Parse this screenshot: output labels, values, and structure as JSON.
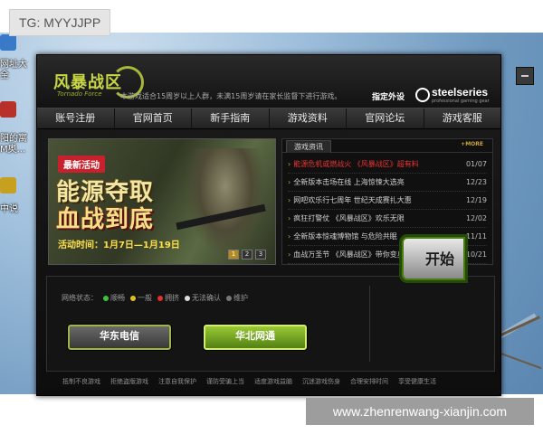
{
  "overlay": {
    "tg_label": "TG: MYYJJPP",
    "watermark": "www.zhenrenwang-xianjin.com"
  },
  "desktop": {
    "icon_texts": [
      "网址大\n全",
      "阳的寓\nM奥...",
      "中说"
    ]
  },
  "launcher": {
    "logo": {
      "title": "风暴战区",
      "subtitle": "Tornado Force"
    },
    "notice": "本游戏适合15周岁以上人群，未满15周岁请在家长监督下进行游戏。",
    "designated_peripheral": "指定外设",
    "sponsor": {
      "name": "steelseries",
      "tagline": "professional gaming gear"
    },
    "nav": [
      "账号注册",
      "官网首页",
      "新手指南",
      "游戏资料",
      "官网论坛",
      "游戏客服"
    ],
    "banner": {
      "tag": "最新活动",
      "line1": "能源夺取",
      "line2": "血战到底",
      "time": "活动时间：1月7日—1月19日",
      "pages": [
        "1",
        "2",
        "3"
      ]
    },
    "news": {
      "tab": "游戏资讯",
      "more": "+MORE",
      "items": [
        {
          "title": "能源危机或燃战火 《风暴战区》超有料",
          "date": "01/07",
          "hot": true
        },
        {
          "title": "全新版本击场在线 上海惊悚大选亮",
          "date": "12/23",
          "hot": false
        },
        {
          "title": "网吧欢乐行七周年 世纪天成赛扎大惠",
          "date": "12/19",
          "hot": false
        },
        {
          "title": "疯狂打警仗 《风暴战区》欢乐无限",
          "date": "12/02",
          "hot": false
        },
        {
          "title": "全新版本惊魂博物馆 与危险共眠",
          "date": "11/11",
          "hot": false
        },
        {
          "title": "血战万圣节 《风暴战区》带你变身南瓜",
          "date": "10/21",
          "hot": false
        }
      ]
    },
    "status": {
      "label": "网络状态：",
      "states": [
        {
          "text": "顺畅",
          "color": "#3bc43b"
        },
        {
          "text": "一般",
          "color": "#e0c020"
        },
        {
          "text": "拥挤",
          "color": "#e03030"
        },
        {
          "text": "无法确认",
          "color": "#dddddd"
        },
        {
          "text": "维护",
          "color": "#777777"
        }
      ]
    },
    "servers": {
      "east": "华东电信",
      "north": "华北网通"
    },
    "start": "开始",
    "footer": [
      "抵制不良游戏",
      "拒绝盗版游戏",
      "注意自我保护",
      "谨防受骗上当",
      "适度游戏益脑",
      "沉迷游戏伤身",
      "合理安排时间",
      "享受健康生活"
    ]
  }
}
